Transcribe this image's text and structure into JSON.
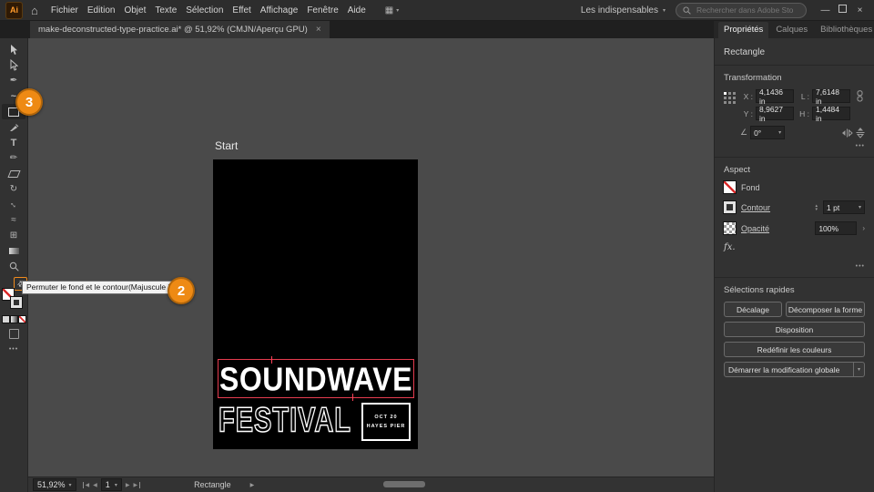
{
  "colors": {
    "accent_orange": "#ee8a14",
    "poster_red": "#ff4257",
    "fill_none_red": "#d92b2b"
  },
  "icons": {
    "home": "⌂",
    "menu_grid": "▦",
    "chevron_down": "▾",
    "minimize": "—",
    "close": "×",
    "pen": "✒",
    "curvature": "~",
    "type_tool": "T",
    "pencil": "✏",
    "rotate": "↻",
    "scale": "↔",
    "width": "≈",
    "shape_builder": "⊞",
    "swap": "⇄",
    "ellipsis": "•••",
    "angle": "∠",
    "arrow_left": "◀",
    "arrow_right": "▶",
    "chevron_right": "›",
    "stepper_up": "▴",
    "stepper_down": "▾"
  },
  "menubar": {
    "app_icon_label": "Ai",
    "items": [
      "Fichier",
      "Edition",
      "Objet",
      "Texte",
      "Sélection",
      "Effet",
      "Affichage",
      "Fenêtre",
      "Aide"
    ],
    "workspace_label": "Les indispensables",
    "search_placeholder": "Rechercher dans Adobe Stock"
  },
  "document_tab": {
    "title": "make-deconstructed-type-practice.ai* @ 51,92% (CMJN/Aperçu GPU)"
  },
  "overlays": {
    "badge_toolbar": "3",
    "badge_swap": "2",
    "tooltip": "Permuter le fond et le contour(Majuscule X)"
  },
  "canvas": {
    "artboard_label": "Start",
    "poster": {
      "title": "SOUNDWAVE",
      "subtitle": "FESTIVAL",
      "date": "OCT 20",
      "venue": "HAYES PIER"
    }
  },
  "panel": {
    "tabs": [
      "Propriétés",
      "Calques",
      "Bibliothèques"
    ],
    "object_type": "Rectangle",
    "transform": {
      "title": "Transformation",
      "x_label": "X :",
      "x_value": "4,1436 in",
      "y_label": "Y :",
      "y_value": "8,9627 in",
      "w_label": "L :",
      "w_value": "7,6148 in",
      "h_label": "H :",
      "h_value": "1,4484 in",
      "angle_value": "0°"
    },
    "aspect": {
      "title": "Aspect",
      "fill_label": "Fond",
      "stroke_label": "Contour",
      "stroke_weight": "1 pt",
      "opacity_label": "Opacité",
      "opacity_value": "100%",
      "fx_label": "fx."
    },
    "quick_actions": {
      "title": "Sélections rapides",
      "offset": "Décalage",
      "expand": "Décomposer la forme",
      "arrange": "Disposition",
      "recolor": "Redéfinir les couleurs",
      "global_edit": "Démarrer la modification globale"
    }
  },
  "statusbar": {
    "zoom": "51,92%",
    "artboard": "1",
    "tool": "Rectangle"
  }
}
